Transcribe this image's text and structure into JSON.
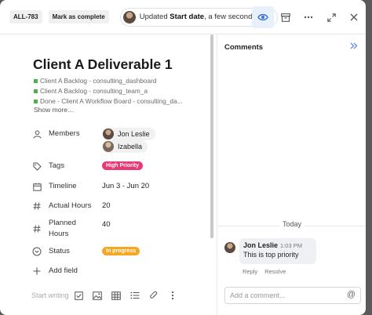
{
  "header": {
    "task_id": "ALL-783",
    "mark_complete_label": "Mark as complete",
    "activity_prefix": "Updated",
    "activity_field": "Start date",
    "activity_suffix": ", a few seconds ago",
    "icons": [
      "eye-icon",
      "archive-icon",
      "more-icon",
      "expand-icon",
      "close-icon"
    ]
  },
  "task": {
    "title": "Client A Deliverable 1",
    "boards": [
      "Client A Backlog - consulting_dashboard",
      "Client A Backlog - consulting_team_a",
      "Done - Client A Workflow Board - consulting_da..."
    ],
    "show_more": "Show more..."
  },
  "fields": {
    "members_label": "Members",
    "members": [
      "Jon Leslie",
      "Izabella"
    ],
    "tags_label": "Tags",
    "tag": "High Priority",
    "timeline_label": "Timeline",
    "timeline": "Jun 3 - Jun 20",
    "actual_hours_label": "Actual Hours",
    "actual_hours": "20",
    "planned_hours_label_1": "Planned",
    "planned_hours_label_2": "Hours",
    "planned_hours": "40",
    "status_label": "Status",
    "status": "In progress",
    "add_field_label": "Add field"
  },
  "composer": {
    "placeholder": "Start writing"
  },
  "comments": {
    "title": "Comments",
    "day": "Today",
    "items": [
      {
        "author": "Jon Leslie",
        "time": "1:03 PM",
        "text": "This is top priority",
        "reply": "Reply",
        "resolve": "Resolve"
      }
    ],
    "input_placeholder": "Add a comment...",
    "mention_symbol": "@"
  },
  "colors": {
    "tag_bg": "#e63976",
    "status_bg": "#f5a623",
    "board_square": "#4caf50",
    "accent": "#4a7fd4"
  }
}
